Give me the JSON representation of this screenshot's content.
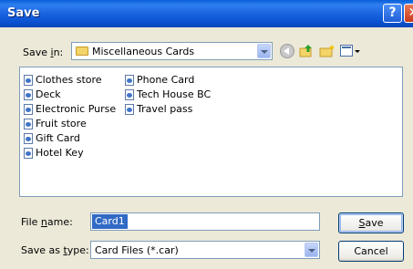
{
  "window": {
    "title": "Save"
  },
  "titlebar": {
    "help_glyph": "?",
    "close_glyph": "✕"
  },
  "toolbar": {
    "save_in_label_pre": "Save ",
    "save_in_label_key": "i",
    "save_in_label_post": "n:",
    "save_in_value": "Miscellaneous Cards"
  },
  "files": [
    {
      "name": "Clothes store"
    },
    {
      "name": "Deck"
    },
    {
      "name": "Electronic Purse"
    },
    {
      "name": "Fruit store"
    },
    {
      "name": "Gift Card"
    },
    {
      "name": "Hotel Key"
    },
    {
      "name": "Phone Card"
    },
    {
      "name": "Tech House BC"
    },
    {
      "name": "Travel pass"
    }
  ],
  "filename": {
    "label_pre": "File ",
    "label_key": "n",
    "label_post": "ame:",
    "value": "Card1"
  },
  "filetype": {
    "label_pre": "Save as ",
    "label_key": "t",
    "label_post": "ype:",
    "value": "Card Files (*.car)"
  },
  "buttons": {
    "save_key": "S",
    "save_rest": "ave",
    "cancel": "Cancel"
  },
  "icons": [
    "folder-icon",
    "back-icon",
    "up-folder-icon",
    "new-folder-icon",
    "views-menu-icon",
    "file-icon"
  ]
}
